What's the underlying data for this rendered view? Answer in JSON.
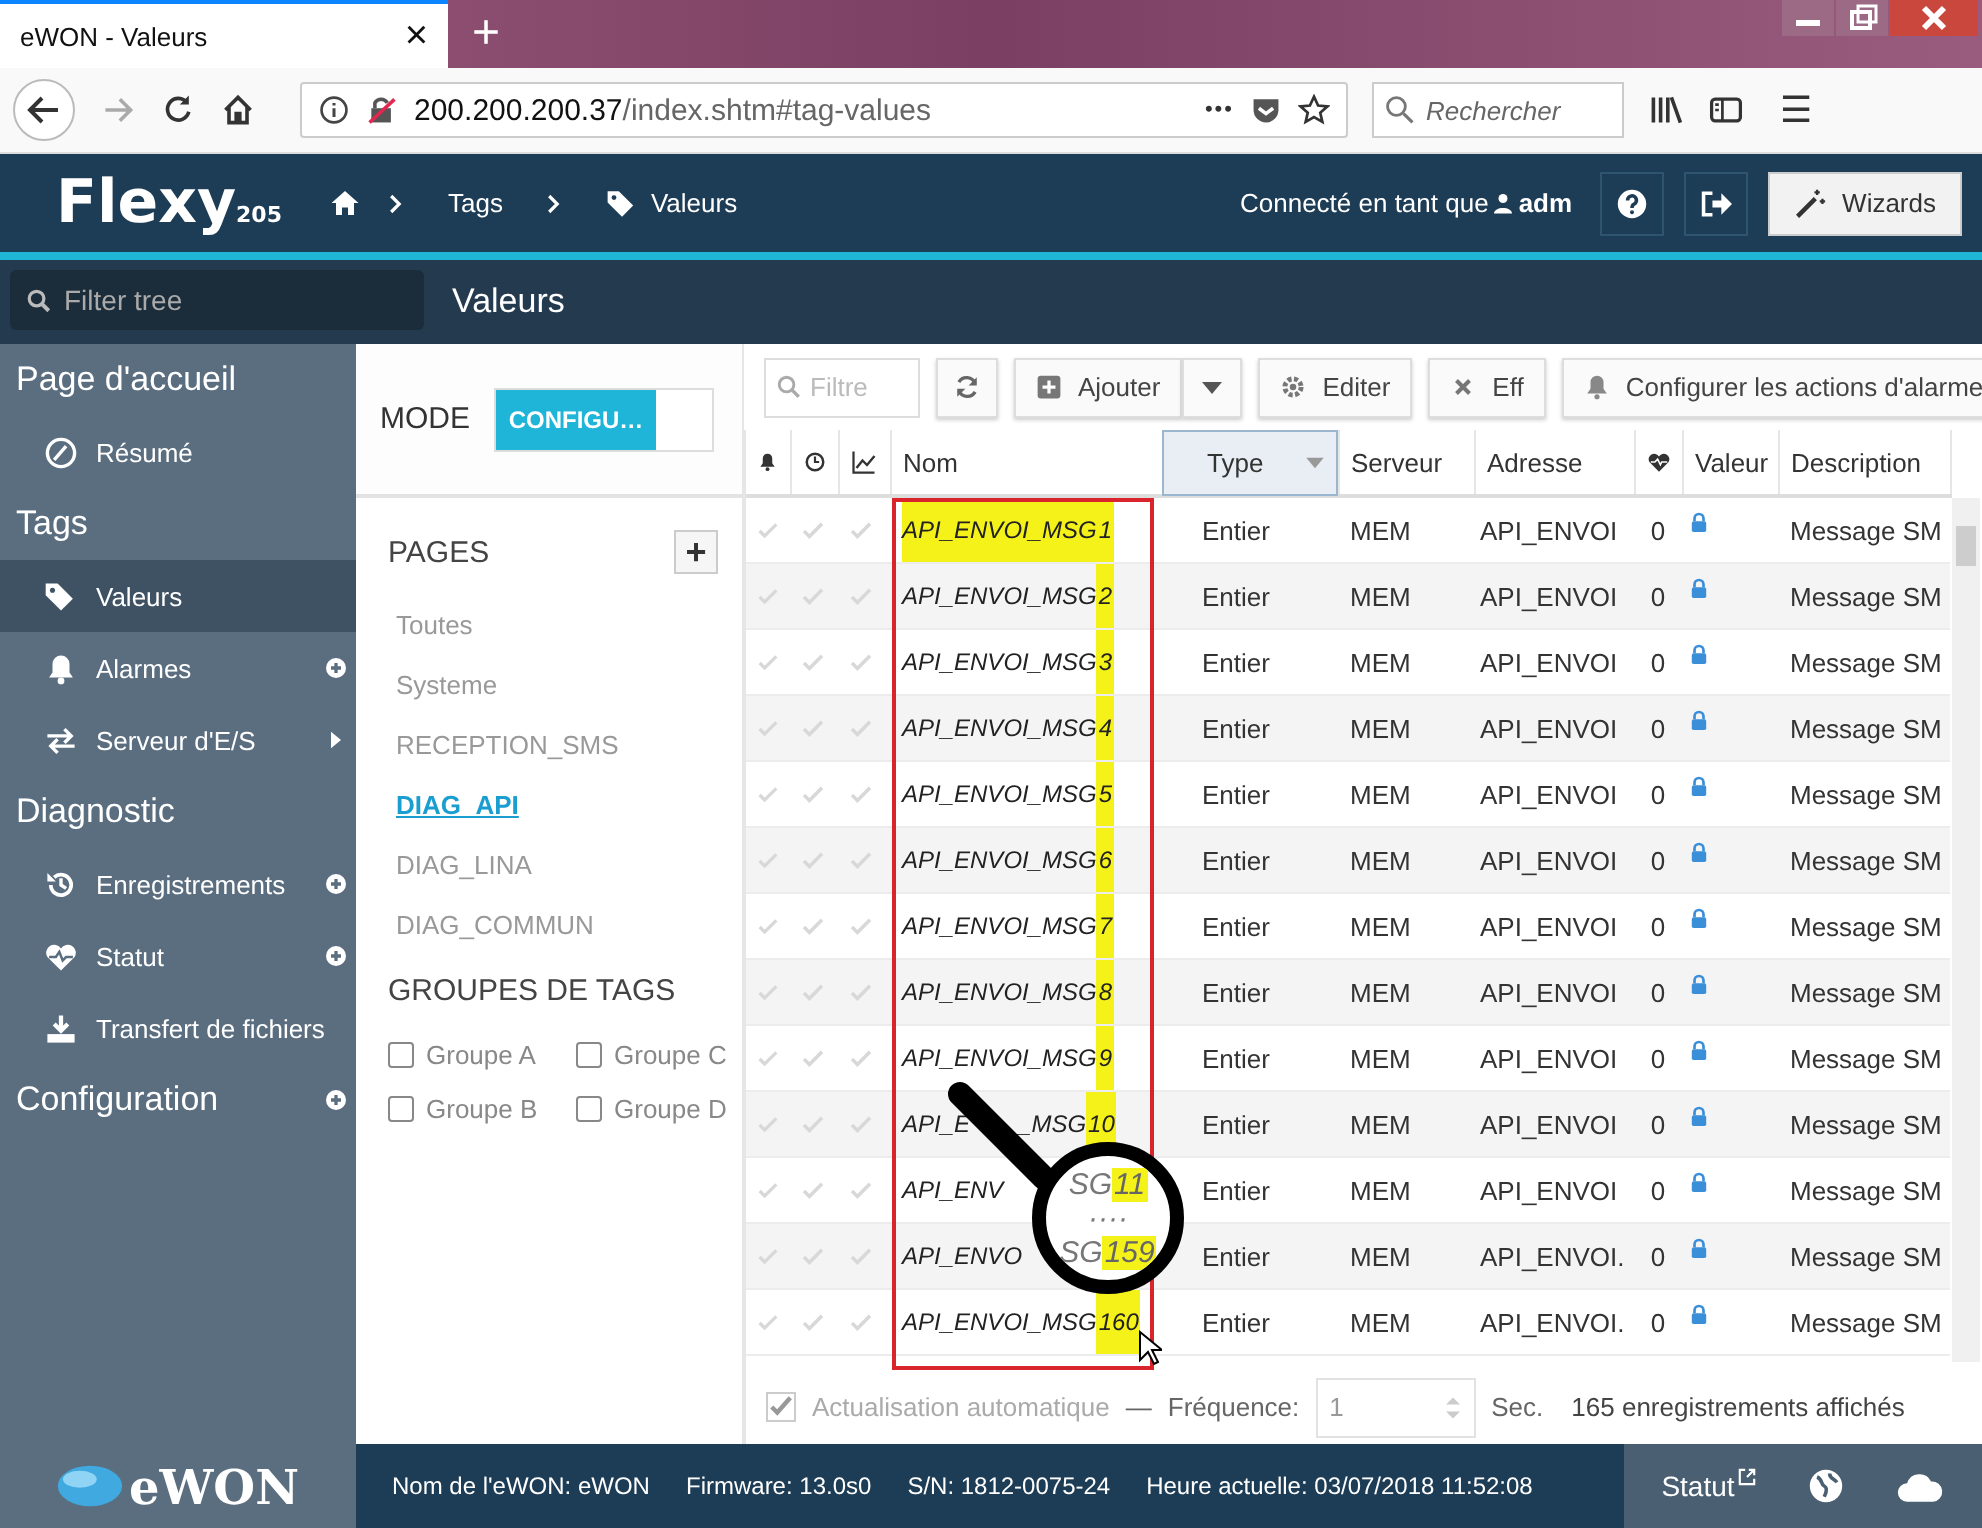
{
  "browser": {
    "tab_title": "eWON - Valeurs",
    "tab_close": "×",
    "new_tab": "+",
    "url_host": "200.200.200.37",
    "url_path": "/index.shtm#tag-values",
    "url_more": "•••",
    "search_placeholder": "Rechercher",
    "menu": "☰"
  },
  "header": {
    "logo": "Flexy",
    "logo_model": "205",
    "breadcrumb": [
      {
        "label": "Tags"
      },
      {
        "label": "Valeurs"
      }
    ],
    "user_prefix": "Connecté en tant que",
    "user": "adm",
    "wizards": "Wizards"
  },
  "tree_filter": {
    "placeholder": "Filter tree"
  },
  "page_title": "Valeurs",
  "sidebar": {
    "sections": [
      {
        "title": "Page d'accueil",
        "kind": "plain",
        "items": [
          {
            "label": "Résumé",
            "selected": false,
            "kind": "plain"
          }
        ]
      },
      {
        "title": "Tags",
        "kind": "plain",
        "items": [
          {
            "label": "Valeurs",
            "selected": true,
            "kind": "plain"
          },
          {
            "label": "Alarmes",
            "selected": false,
            "kind": "plus"
          },
          {
            "label": "Serveur d'E/S",
            "selected": false,
            "kind": "arrow"
          }
        ]
      },
      {
        "title": "Diagnostic",
        "kind": "plain",
        "items": [
          {
            "label": "Enregistrements",
            "selected": false,
            "kind": "plus"
          },
          {
            "label": "Statut",
            "selected": false,
            "kind": "plus"
          },
          {
            "label": "Transfert de fichiers",
            "selected": false,
            "kind": "plain"
          }
        ]
      },
      {
        "title": "Configuration",
        "kind": "plus"
      }
    ],
    "logo": "eWON"
  },
  "mode": {
    "label": "MODE",
    "value": "CONFIGU…",
    "on": true
  },
  "pages": {
    "title": "PAGES",
    "add": "+",
    "items": [
      {
        "label": "Toutes",
        "selected": false
      },
      {
        "label": "Systeme",
        "selected": false
      },
      {
        "label": "RECEPTION_SMS",
        "selected": false
      },
      {
        "label": "DIAG_API",
        "selected": true
      },
      {
        "label": "DIAG_LINA",
        "selected": false
      },
      {
        "label": "DIAG_COMMUN",
        "selected": false
      }
    ]
  },
  "groups": {
    "title": "GROUPES DE TAGS",
    "items": [
      {
        "label": "Groupe A",
        "checked": false
      },
      {
        "label": "Groupe C",
        "checked": false
      },
      {
        "label": "Groupe B",
        "checked": false
      },
      {
        "label": "Groupe D",
        "checked": false
      }
    ]
  },
  "toolbar": {
    "filter_placeholder": "Filtre",
    "add": "Ajouter",
    "edit": "Editer",
    "delete": "Eff",
    "alarm_actions": "Configurer les actions d'alarme"
  },
  "columns": [
    {
      "kind": "bell",
      "selected": false
    },
    {
      "kind": "clock",
      "selected": false
    },
    {
      "kind": "chart",
      "selected": false
    },
    {
      "kind": "text",
      "label": "Nom",
      "selected": false
    },
    {
      "kind": "text",
      "label": "Type",
      "selected": true
    },
    {
      "kind": "text",
      "label": "Serveur",
      "selected": false
    },
    {
      "kind": "text",
      "label": "Adresse",
      "selected": false
    },
    {
      "kind": "heart",
      "selected": false
    },
    {
      "kind": "text",
      "label": "Valeur",
      "selected": false
    },
    {
      "kind": "text",
      "label": "Description",
      "selected": false
    }
  ],
  "rows": [
    {
      "name": "API_ENVOI_MSG",
      "number": "1",
      "name_highlighted": true,
      "number_highlighted": true,
      "type": "Entier",
      "server": "MEM",
      "address": "API_ENVOI",
      "value": "0",
      "locked": true,
      "description": "Message SM"
    },
    {
      "name": "API_ENVOI_MSG",
      "number": "2",
      "name_highlighted": false,
      "number_highlighted": true,
      "type": "Entier",
      "server": "MEM",
      "address": "API_ENVOI",
      "value": "0",
      "locked": true,
      "description": "Message SM"
    },
    {
      "name": "API_ENVOI_MSG",
      "number": "3",
      "name_highlighted": false,
      "number_highlighted": true,
      "type": "Entier",
      "server": "MEM",
      "address": "API_ENVOI",
      "value": "0",
      "locked": true,
      "description": "Message SM"
    },
    {
      "name": "API_ENVOI_MSG",
      "number": "4",
      "name_highlighted": false,
      "number_highlighted": true,
      "type": "Entier",
      "server": "MEM",
      "address": "API_ENVOI",
      "value": "0",
      "locked": true,
      "description": "Message SM"
    },
    {
      "name": "API_ENVOI_MSG",
      "number": "5",
      "name_highlighted": false,
      "number_highlighted": true,
      "type": "Entier",
      "server": "MEM",
      "address": "API_ENVOI",
      "value": "0",
      "locked": true,
      "description": "Message SM"
    },
    {
      "name": "API_ENVOI_MSG",
      "number": "6",
      "name_highlighted": false,
      "number_highlighted": true,
      "type": "Entier",
      "server": "MEM",
      "address": "API_ENVOI",
      "value": "0",
      "locked": true,
      "description": "Message SM"
    },
    {
      "name": "API_ENVOI_MSG",
      "number": "7",
      "name_highlighted": false,
      "number_highlighted": true,
      "type": "Entier",
      "server": "MEM",
      "address": "API_ENVOI",
      "value": "0",
      "locked": true,
      "description": "Message SM"
    },
    {
      "name": "API_ENVOI_MSG",
      "number": "8",
      "name_highlighted": false,
      "number_highlighted": true,
      "type": "Entier",
      "server": "MEM",
      "address": "API_ENVOI",
      "value": "0",
      "locked": true,
      "description": "Message SM"
    },
    {
      "name": "API_ENVOI_MSG",
      "number": "9",
      "name_highlighted": false,
      "number_highlighted": true,
      "type": "Entier",
      "server": "MEM",
      "address": "API_ENVOI",
      "value": "0",
      "locked": true,
      "description": "Message SM"
    },
    {
      "name": "API_E",
      "tail": "_MSG",
      "number": "10",
      "name_highlighted": false,
      "number_highlighted": true,
      "type": "Entier",
      "server": "MEM",
      "address": "API_ENVOI",
      "value": "0",
      "locked": true,
      "description": "Message SM"
    },
    {
      "name": "API_ENV",
      "name_highlighted": false,
      "type": "Entier",
      "server": "MEM",
      "address": "API_ENVOI",
      "value": "0",
      "locked": true,
      "description": "Message SM"
    },
    {
      "name": "API_ENVO",
      "name_highlighted": false,
      "type": "Entier",
      "server": "MEM",
      "address": "API_ENVOI.",
      "value": "0",
      "locked": true,
      "description": "Message SM"
    },
    {
      "name": "API_ENVOI_MSG",
      "number": "160",
      "name_highlighted": false,
      "number_highlighted": true,
      "type": "Entier",
      "server": "MEM",
      "address": "API_ENVOI.",
      "value": "0",
      "locked": true,
      "description": "Message SM"
    }
  ],
  "magnifier": {
    "lines": [
      {
        "text": "SG",
        "mark": "11"
      },
      {
        "text": "····"
      },
      {
        "text": "SG",
        "mark": "159"
      }
    ]
  },
  "footer": {
    "auto_refresh": "Actualisation automatique",
    "auto_refresh_checked": true,
    "dash": "—",
    "frequency_label": "Fréquence:",
    "frequency": "1",
    "unit": "Sec.",
    "count": "165 enregistrements affichés"
  },
  "status_bar": {
    "items": [
      "Nom de l'eWON: eWON",
      "Firmware: 13.0s0",
      "S/N: 1812-0075-24",
      "Heure actuelle: 03/07/2018 11:52:08"
    ],
    "status": "Statut"
  }
}
